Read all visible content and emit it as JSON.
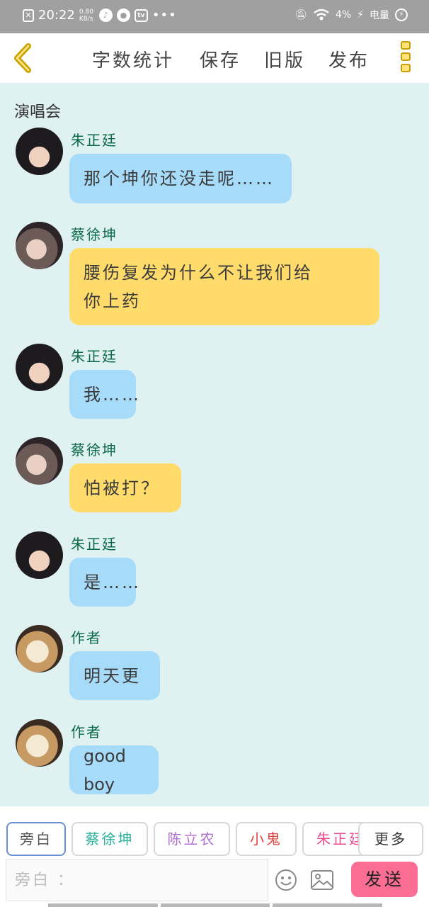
{
  "status_bar": {
    "time": "20:22",
    "net_rate": "0.80 KB/s",
    "battery_percent": "4%",
    "battery_label": "电量",
    "icons": [
      "notification-x-icon",
      "app-icon",
      "wechat-icon",
      "video-app-icon",
      "more-dots-icon",
      "mute-bell-icon",
      "wifi-icon",
      "signal-icon",
      "charging-icon"
    ]
  },
  "header": {
    "word_count": "字数统计",
    "save": "保存",
    "old_version": "旧版",
    "publish": "发布"
  },
  "title": "演唱会",
  "messages": [
    {
      "sender": "朱正廷",
      "text": "那个坤你还没走呢……",
      "color": "blue",
      "avatar": "avatar-zhu"
    },
    {
      "sender": "蔡徐坤",
      "text": "腰伤复发为什么不让我们给你上药",
      "line1": "腰伤复发为什么不让我们给",
      "line2": "你上药",
      "color": "yellow",
      "avatar": "avatar-cai"
    },
    {
      "sender": "朱正廷",
      "text": "我……",
      "color": "blue",
      "avatar": "avatar-zhu"
    },
    {
      "sender": "蔡徐坤",
      "text": "怕被打？",
      "color": "yellow",
      "avatar": "avatar-cai"
    },
    {
      "sender": "朱正廷",
      "text": "是……",
      "color": "blue",
      "avatar": "avatar-zhu"
    },
    {
      "sender": "作者",
      "text": "明天更",
      "color": "blue",
      "avatar": "avatar-dog"
    },
    {
      "sender": "作者",
      "text": "good boy",
      "color": "blue",
      "avatar": "avatar-dog"
    }
  ],
  "chips": [
    {
      "label": "旁白",
      "color": "#555555",
      "selected": true
    },
    {
      "label": "蔡徐坤",
      "color": "#27b09a"
    },
    {
      "label": "陈立农",
      "color": "#b06fd0"
    },
    {
      "label": "小鬼",
      "color": "#e0443c"
    },
    {
      "label": "朱正廷",
      "color": "#ea4d8f"
    },
    {
      "label": "更多",
      "color": "#333333"
    }
  ],
  "composer": {
    "placeholder": "旁白 ：",
    "send": "发送"
  },
  "colors": {
    "bubble_blue": "#a6dbf9",
    "bubble_yellow": "#ffdb6b",
    "sender_green": "#0a6a45",
    "send_pink": "#fc6d93",
    "background": "#e0f1f2"
  }
}
